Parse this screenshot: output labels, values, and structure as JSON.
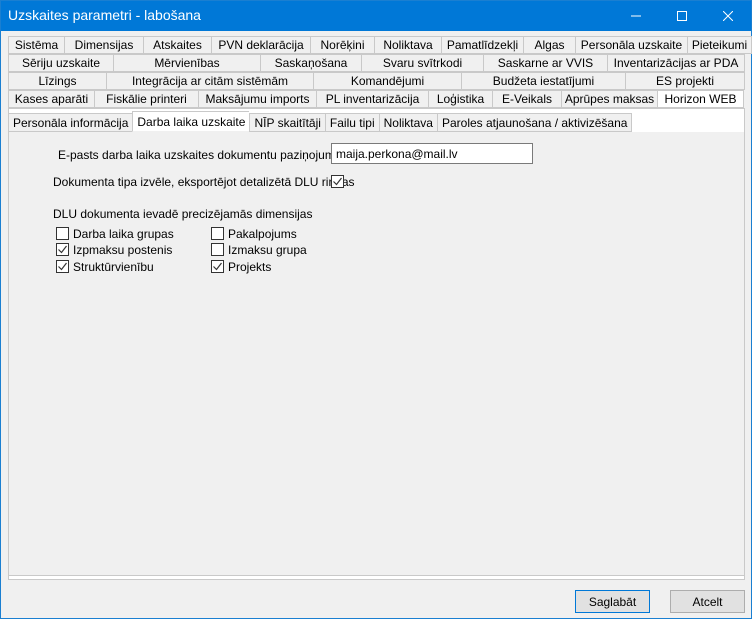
{
  "window": {
    "title": "Uzskaites parametri - labošana"
  },
  "tabs_row1": [
    "Sistēma",
    "Dimensijas",
    "Atskaites",
    "PVN deklarācija",
    "Norēķini",
    "Noliktava",
    "Pamatlīdzekļi",
    "Algas",
    "Personāla uzskaite",
    "Pieteikumi"
  ],
  "tabs_row2": [
    "Sēriju uzskaite",
    "Mērvienības",
    "Saskaņošana",
    "Svaru svītrkodi",
    "Saskarne ar VVIS",
    "Inventarizācijas ar PDA"
  ],
  "tabs_row3": [
    "Līzings",
    "Integrācija ar citām sistēmām",
    "Komandējumi",
    "Budžeta iestatījumi",
    "ES projekti"
  ],
  "tabs_row4": [
    "Kases aparāti",
    "Fiskālie printeri",
    "Maksājumu imports",
    "PL inventarizācija",
    "Loģistika",
    "E-Veikals",
    "Aprūpes maksas",
    "Horizon WEB"
  ],
  "inner_tabs": [
    "Personāla informācija",
    "Darba laika uzskaite",
    "NĪP skaitītāji",
    "Failu tipi",
    "Noliktava",
    "Paroles atjaunošana / aktivizēšana"
  ],
  "form": {
    "email_label": "E-pasts darba laika uzskaites dokumentu paziņojumiem:",
    "email_value": "maija.perkona@mail.lv",
    "doc_type_label": "Dokumenta tipa izvēle, eksportējot detalizētā DLU rindas",
    "doc_type_checked": true,
    "dims_heading": "DLU dokumenta ievadē precizējamās dimensijas",
    "dims_left": [
      {
        "label": "Darba laika grupas",
        "checked": false
      },
      {
        "label": "Izpmaksu postenis",
        "checked": true
      },
      {
        "label": "Struktūrvienību",
        "checked": true
      }
    ],
    "dims_right": [
      {
        "label": "Pakalpojums",
        "checked": false
      },
      {
        "label": "Izmaksu grupa",
        "checked": false
      },
      {
        "label": "Projekts",
        "checked": true
      }
    ]
  },
  "buttons": {
    "save": "Saglabāt",
    "cancel": "Atcelt"
  }
}
